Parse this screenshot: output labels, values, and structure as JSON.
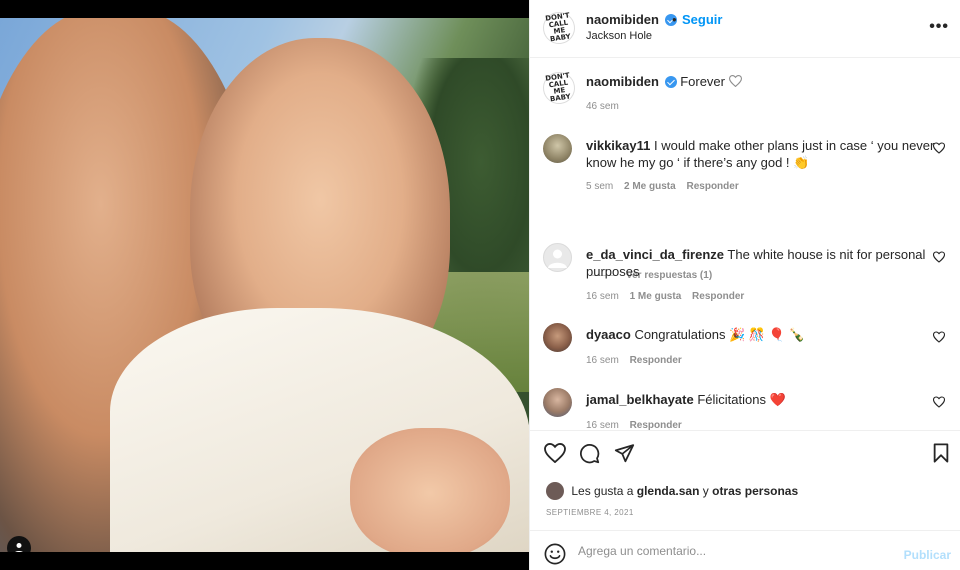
{
  "post": {
    "username": "naomibiden",
    "dot": "•",
    "follow_label": "Seguir",
    "location": "Jackson Hole",
    "more_label": "•••",
    "logo_text": "DON'T CALL ME BABY"
  },
  "caption": {
    "username": "naomibiden",
    "text": "Forever",
    "time": "46 sem"
  },
  "comments": [
    {
      "username": "vikkikay11",
      "text": "I would make other plans just in case ‘ you never know he my go ‘ if there’s any god ! 👏",
      "time": "5 sem",
      "likes": "2 Me gusta",
      "reply": "Responder"
    },
    {
      "username": "e_da_vinci_da_firenze",
      "text": "The white house is nit for personal purposes",
      "time": "16 sem",
      "likes": "1 Me gusta",
      "reply": "Responder"
    },
    {
      "username": "dyaaco",
      "text": "Congratulations 🎉 🎊 🎈 🍾",
      "time": "16 sem",
      "reply": "Responder"
    },
    {
      "username": "jamal_belkhayate",
      "text": "Félicitations ❤️",
      "time": "16 sem",
      "reply": "Responder"
    }
  ],
  "view_replies": "Ver respuestas (1)",
  "actions": {
    "liked_by_prefix": "Les gusta a",
    "liked_by_user": "glenda.san",
    "liked_by_joiner": "y",
    "liked_by_others": "otras personas",
    "date": "SEPTIEMBRE 4, 2021"
  },
  "add_comment": {
    "placeholder": "Agrega un comentario...",
    "post_label": "Publicar"
  },
  "icons": {
    "verified": "verified-badge-icon",
    "heart": "heart-icon",
    "comment": "comment-icon",
    "share": "share-icon",
    "save": "bookmark-icon",
    "emoji": "emoji-icon",
    "tag": "user-tag-icon"
  },
  "colors": {
    "link_blue": "#0095f6",
    "verified_blue": "#3897f0",
    "muted": "#8e8e8e",
    "publish_disabled": "#b2dffc"
  }
}
